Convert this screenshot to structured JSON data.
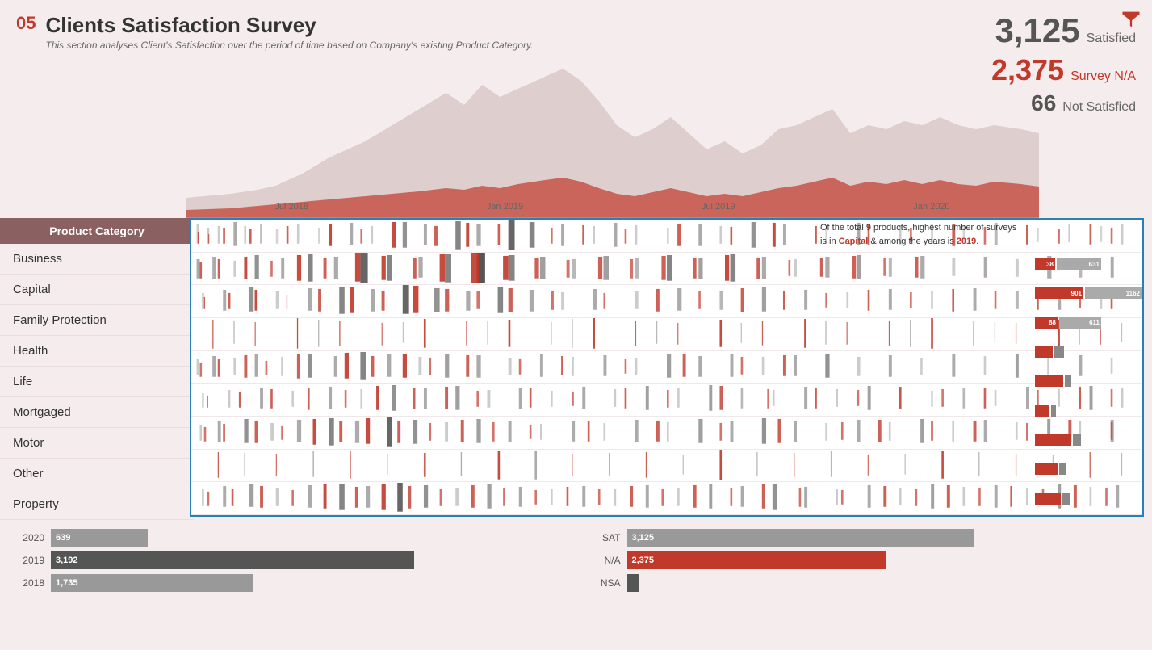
{
  "page": {
    "section_num": "05",
    "title": "Clients Satisfaction Survey",
    "subtitle": "This section analyses Client's Satisfaction over the period of time based on Company's existing Product Category."
  },
  "top_stats": {
    "satisfied_num": "3,125",
    "satisfied_label": "Satisfied",
    "survey_na_num": "2,375",
    "survey_na_label": "Survey N/A",
    "not_satisfied_num": "66",
    "not_satisfied_label": "Not Satisfied"
  },
  "summary": {
    "text_prefix": "Of the total",
    "products_count": "9",
    "text_mid": "products, highest number of surveys is in",
    "highlight_word": "Capital",
    "text_mid2": "& among the years is",
    "highlight_year": "2019",
    "text_end": "."
  },
  "time_axis": {
    "labels": [
      "Jul 2018",
      "Jan 2019",
      "Jul 2019",
      "Jan 2020"
    ]
  },
  "product_categories": {
    "header": "Product Category",
    "items": [
      "Business",
      "Capital",
      "Family Protection",
      "Health",
      "Life",
      "Mortgaged",
      "Motor",
      "Other",
      "Property"
    ]
  },
  "right_bars": [
    {
      "red": 38,
      "gray": 631,
      "red_label": "38",
      "gray_label": "631"
    },
    {
      "red": 901,
      "gray": 1162,
      "red_label": "901",
      "gray_label": "1162"
    },
    {
      "red": 88,
      "gray": 611,
      "red_label": "88",
      "gray_label": "611"
    },
    {
      "red": 30,
      "gray": 0,
      "red_label": "",
      "gray_label": ""
    },
    {
      "red": 60,
      "gray": 0,
      "red_label": "",
      "gray_label": ""
    },
    {
      "red": 30,
      "gray": 0,
      "red_label": "",
      "gray_label": ""
    },
    {
      "red": 70,
      "gray": 0,
      "red_label": "",
      "gray_label": ""
    },
    {
      "red": 50,
      "gray": 0,
      "red_label": "",
      "gray_label": ""
    },
    {
      "red": 60,
      "gray": 0,
      "red_label": "",
      "gray_label": ""
    }
  ],
  "bottom_left": {
    "title": "",
    "bars": [
      {
        "label": "2020",
        "value": 639,
        "max": 3500,
        "color": "light",
        "text": "639"
      },
      {
        "label": "2019",
        "value": 3192,
        "max": 3500,
        "color": "dark",
        "text": "3,192"
      },
      {
        "label": "2018",
        "value": 1735,
        "max": 3500,
        "color": "light",
        "text": "1,735"
      }
    ]
  },
  "bottom_right": {
    "bars": [
      {
        "label": "SAT",
        "value": 3125,
        "max": 3200,
        "color": "lightgray",
        "text": "3,125"
      },
      {
        "label": "N/A",
        "value": 2375,
        "max": 3200,
        "color": "red",
        "text": "2,375"
      },
      {
        "label": "NSA",
        "value": 66,
        "max": 3200,
        "color": "dark",
        "text": ""
      }
    ]
  }
}
